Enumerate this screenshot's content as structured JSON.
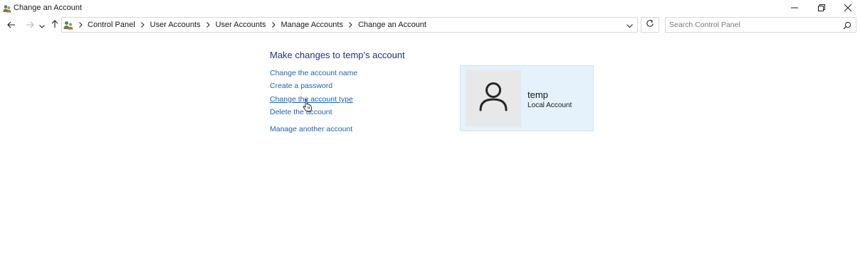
{
  "window": {
    "title": "Change an Account",
    "controls": {
      "minimize_icon": "minimize-icon",
      "maximize_icon": "restore-icon",
      "close_icon": "close-icon"
    }
  },
  "nav": {
    "back_icon": "arrow-left-icon",
    "forward_icon": "arrow-right-icon",
    "recent_icon": "chevron-down-icon",
    "up_icon": "arrow-up-icon",
    "breadcrumbs": [
      "Control Panel",
      "User Accounts",
      "User Accounts",
      "Manage Accounts",
      "Change an Account"
    ],
    "refresh_icon": "refresh-icon"
  },
  "search": {
    "placeholder": "Search Control Panel",
    "value": ""
  },
  "main": {
    "heading": "Make changes to temp's account",
    "links": [
      "Change the account name",
      "Create a password",
      "Change the account type",
      "Delete the account",
      "Manage another account"
    ]
  },
  "account": {
    "name": "temp",
    "type": "Local Account",
    "avatar_icon": "user-icon"
  },
  "colors": {
    "heading": "#1e3287",
    "link": "#1e64aa",
    "tile_background": "#e5f1fb",
    "tile_border": "#cce4f7",
    "avatar_background": "#e8e8e8"
  }
}
